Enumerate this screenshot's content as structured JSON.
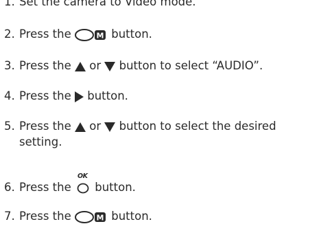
{
  "steps": [
    {
      "num": "1.",
      "parts": [
        "Set the camera to Video mode."
      ]
    },
    {
      "num": "2.",
      "before": "Press the ",
      "after": " button."
    },
    {
      "num": "3.",
      "before": "Press the ",
      "mid": " or ",
      "after": " button to select “AUDIO”."
    },
    {
      "num": "4.",
      "before": "Press the ",
      "after": " button."
    },
    {
      "num": "5.",
      "before": "Press the ",
      "mid": " or ",
      "after": " button to select the desired",
      "cont": "setting."
    },
    {
      "num": "6.",
      "before": "Press the ",
      "after": " button."
    },
    {
      "num": "7.",
      "before": "Press the ",
      "after": " button."
    }
  ],
  "icons": {
    "menu_button": "menu-button-icon",
    "menu_letter": "M",
    "up": "up-arrow-icon",
    "down": "down-arrow-icon",
    "right": "right-arrow-icon",
    "ok_label": "OK",
    "ok_button": "ok-button-icon"
  }
}
